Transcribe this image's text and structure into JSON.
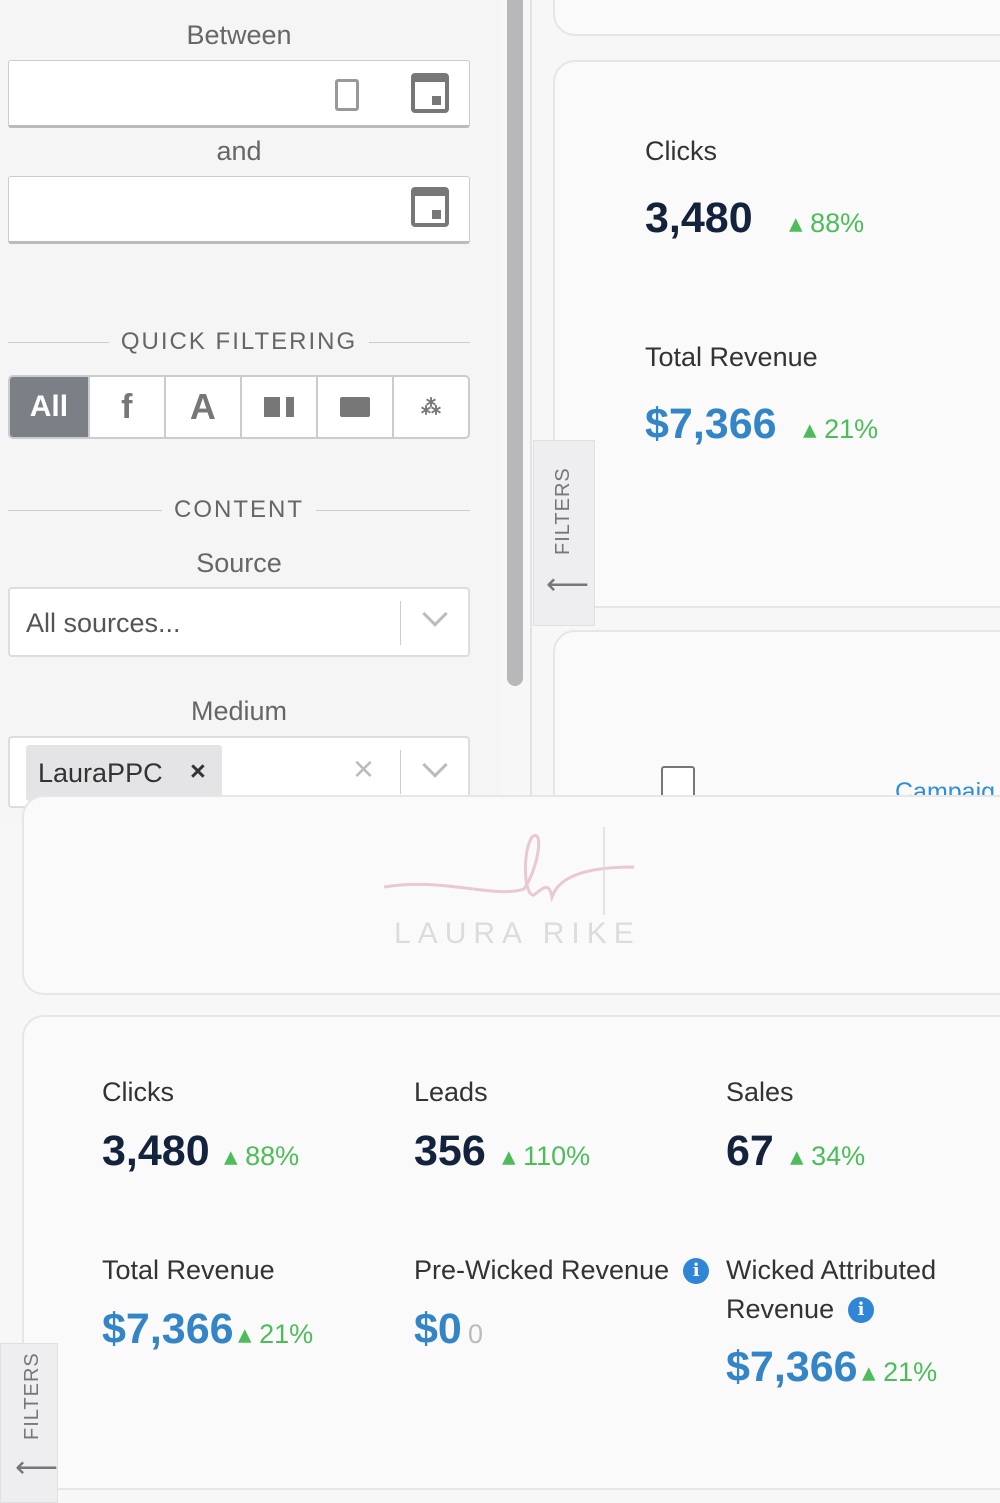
{
  "filters": {
    "between_label": "Between",
    "and_label": "and",
    "quick_filtering": "QUICK FILTERING",
    "quick_buttons": [
      "All",
      "f",
      "A"
    ],
    "content": "CONTENT",
    "source_label": "Source",
    "source_placeholder": "All sources...",
    "medium_label": "Medium",
    "medium_tag": "LauraPPC",
    "tab_label": "FILTERS"
  },
  "right_card": {
    "clicks_label": "Clicks",
    "clicks": "3,480",
    "clicks_pct": "88%",
    "revenue_label": "Total Revenue",
    "revenue": "$7,366",
    "revenue_pct": "21%",
    "campaign_link": "Campaig"
  },
  "logo": {
    "text": "LAURA RIKE"
  },
  "stats": {
    "clicks_label": "Clicks",
    "clicks": "3,480",
    "clicks_pct": "88%",
    "leads_label": "Leads",
    "leads": "356",
    "leads_pct": "110%",
    "sales_label": "Sales",
    "sales": "67",
    "sales_pct": "34%",
    "revenue_label": "Total Revenue",
    "revenue": "$7,366",
    "revenue_pct": "21%",
    "prewicked_label": "Pre-Wicked Revenue",
    "prewicked": "$0",
    "prewicked_change": "0",
    "wicked_label1": "Wicked Attributed",
    "wicked_label2": "Revenue",
    "wicked": "$7,366",
    "wicked_pct": "21%",
    "info_glyph": "i"
  },
  "colors": {
    "navy": "#14233d",
    "blue": "#3485c7",
    "green": "#4cbd59"
  }
}
